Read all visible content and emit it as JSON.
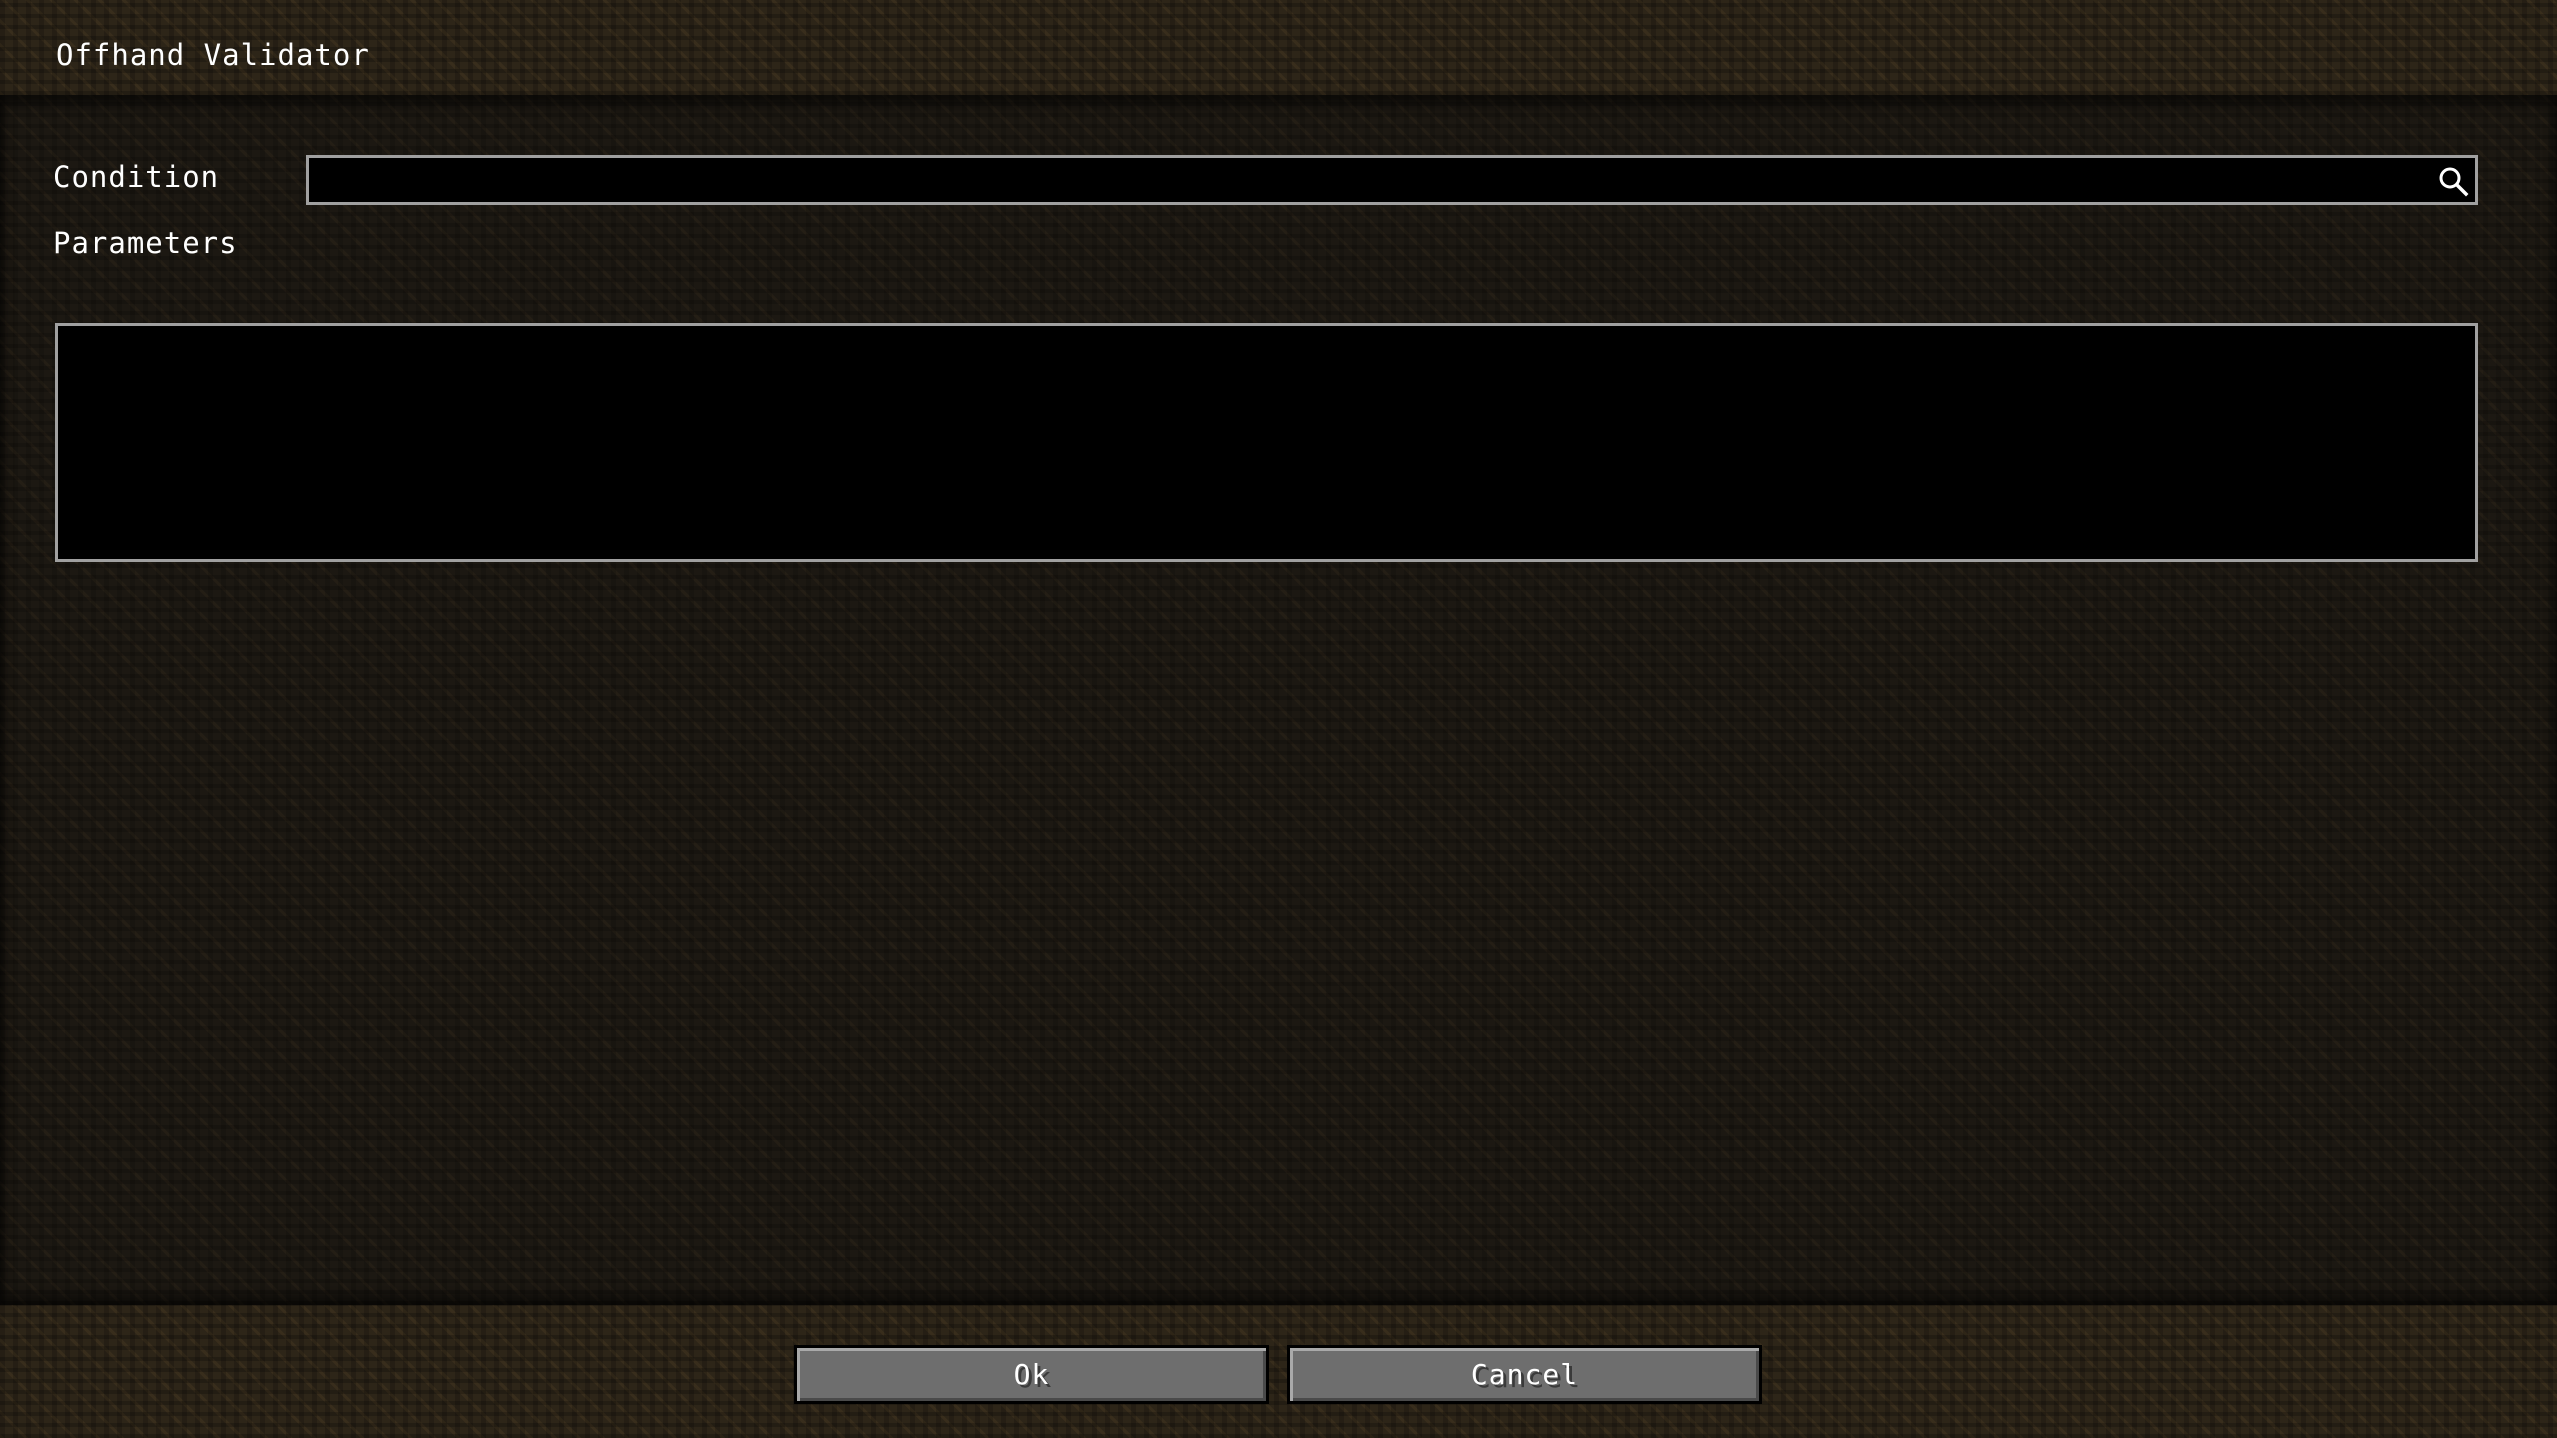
{
  "window": {
    "title": "Offhand Validator"
  },
  "form": {
    "condition_label": "Condition",
    "condition_value": "",
    "condition_placeholder": "",
    "parameters_label": "Parameters"
  },
  "icons": {
    "search": "search-icon"
  },
  "footer": {
    "ok_label": "Ok",
    "cancel_label": "Cancel"
  },
  "colors": {
    "field_background": "#000000",
    "field_border": "#a0a0a0",
    "button_face": "#6e6e6e",
    "text": "#ffffff"
  }
}
